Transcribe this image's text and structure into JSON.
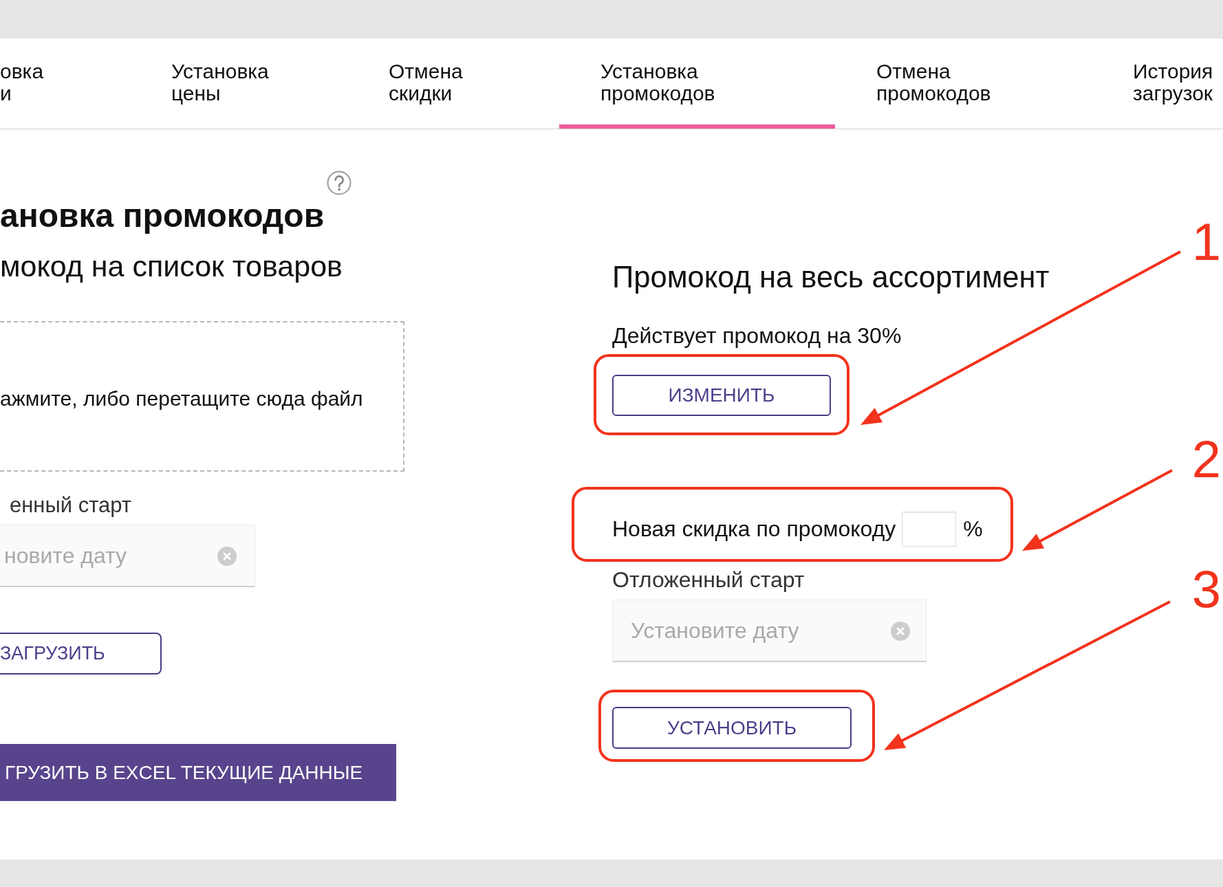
{
  "tabs": [
    {
      "label": "овка\nи",
      "selected": false
    },
    {
      "label": "Установка\nцены",
      "selected": false
    },
    {
      "label": "Отмена\nскидки",
      "selected": false
    },
    {
      "label": "Установка\nпромокодов",
      "selected": true
    },
    {
      "label": "Отмена\nпромокодов",
      "selected": false
    },
    {
      "label": "История\nзагрузок",
      "selected": false
    }
  ],
  "left_panel": {
    "title": "ановка промокодов",
    "subtitle": "мокод на список товаров",
    "drop_zone": {
      "text": "ажмите, либо перетащите сюда файл"
    },
    "delayed_start": {
      "label": "енный старт",
      "placeholder": "новите дату"
    },
    "upload_button": "ЗАГРУЗИТЬ",
    "export_button": "ГРУЗИТЬ В EXCEL ТЕКУЩИЕ ДАННЫЕ"
  },
  "right_panel": {
    "title": "Промокод на весь ассортимент",
    "current_promo": "Действует промокод на 30%",
    "change_button": "ИЗМЕНИТЬ",
    "new_discount": {
      "label": "Новая скидка по промокоду",
      "unit": "%"
    },
    "delayed_start": {
      "label": "Отложенный старт",
      "placeholder": "Установите дату"
    },
    "set_button": "УСТАНОВИТЬ"
  },
  "annotations": [
    {
      "number": "1"
    },
    {
      "number": "2"
    },
    {
      "number": "3"
    }
  ]
}
